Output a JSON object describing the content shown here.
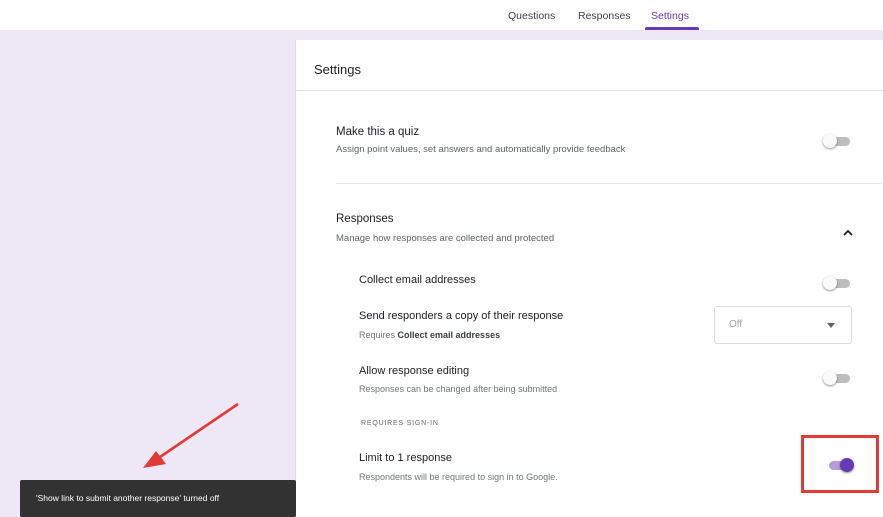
{
  "tabs": {
    "questions": "Questions",
    "responses": "Responses",
    "settings": "Settings",
    "active": "Settings"
  },
  "settings": {
    "title": "Settings",
    "quiz": {
      "title": "Make this a quiz",
      "description": "Assign point values, set answers and automatically provide feedback",
      "enabled": false
    },
    "responses": {
      "title": "Responses",
      "description": "Manage how responses are collected and protected",
      "expanded": true,
      "items": [
        {
          "title": "Collect email addresses",
          "enabled": false
        },
        {
          "title": "Send responders a copy of their response",
          "description_prefix": "Requires ",
          "description_bold": "Collect email addresses",
          "dropdown_value": "Off"
        },
        {
          "title": "Allow response editing",
          "description": "Responses can be changed after being submitted",
          "enabled": false
        }
      ],
      "requires_signin_label": "REQUIRES SIGN-IN",
      "limit": {
        "title": "Limit to 1 response",
        "description": "Respondents will be required to sign in to Google.",
        "enabled": true
      }
    }
  },
  "snackbar": {
    "message": "'Show link to submit another response' turned off"
  },
  "colors": {
    "accent": "#673ab7",
    "background": "#ede7f6",
    "annotation": "#e53935"
  }
}
